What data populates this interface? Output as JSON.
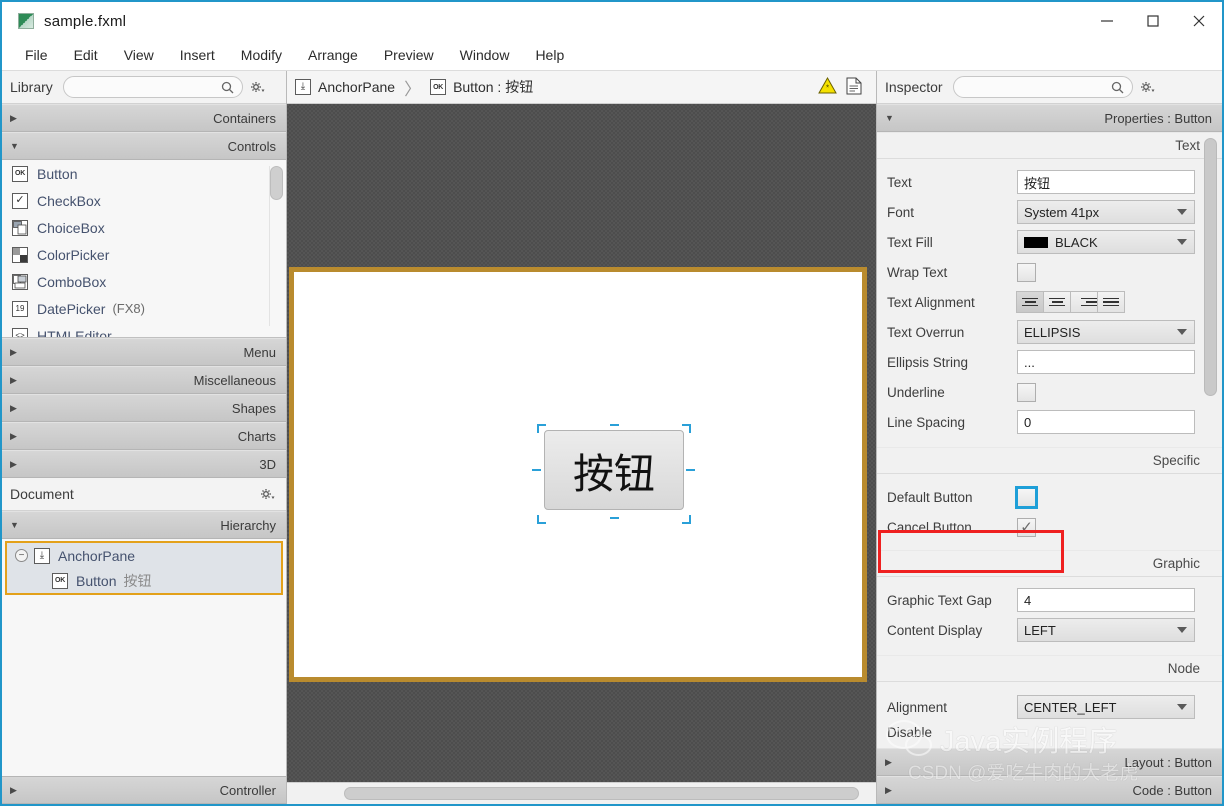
{
  "window": {
    "title": "sample.fxml",
    "app_icon": "fxml-file-icon",
    "buttons": {
      "minimize": "—",
      "maximize": "□",
      "close": "✕"
    }
  },
  "menubar": {
    "items": [
      "File",
      "Edit",
      "View",
      "Insert",
      "Modify",
      "Arrange",
      "Preview",
      "Window",
      "Help"
    ]
  },
  "library": {
    "title": "Library",
    "search_placeholder": "",
    "search_value": "",
    "gear_label": "⚙",
    "sections": [
      {
        "label": "Containers",
        "expanded": false
      },
      {
        "label": "Controls",
        "expanded": true
      },
      {
        "label": "Menu",
        "expanded": false
      },
      {
        "label": "Miscellaneous",
        "expanded": false
      },
      {
        "label": "Shapes",
        "expanded": false
      },
      {
        "label": "Charts",
        "expanded": false
      },
      {
        "label": "3D",
        "expanded": false
      }
    ],
    "controls": [
      {
        "icon": "ok-button-icon",
        "glyph": "OK",
        "label": "Button",
        "sub": ""
      },
      {
        "icon": "checkbox-icon",
        "glyph": "✓",
        "label": "CheckBox",
        "sub": ""
      },
      {
        "icon": "choicebox-icon",
        "glyph": "▤",
        "label": "ChoiceBox",
        "sub": ""
      },
      {
        "icon": "colorpicker-icon",
        "glyph": "▩",
        "label": "ColorPicker",
        "sub": ""
      },
      {
        "icon": "combobox-icon",
        "glyph": "▤",
        "label": "ComboBox",
        "sub": ""
      },
      {
        "icon": "datepicker-icon",
        "glyph": "19",
        "label": "DatePicker",
        "sub": "(FX8)"
      },
      {
        "icon": "htmleditor-icon",
        "glyph": "<>",
        "label": "HTMLEditor",
        "sub": ""
      }
    ]
  },
  "document": {
    "title": "Document",
    "gear_label": "⚙",
    "hierarchy_label": "Hierarchy",
    "controller_label": "Controller",
    "tree": [
      {
        "icon": "anchorpane-icon",
        "glyph": "⤓",
        "label": "AnchorPane",
        "value": "",
        "selected": false,
        "depth": 0
      },
      {
        "icon": "ok-button-icon",
        "glyph": "OK",
        "label": "Button",
        "value": "按钮",
        "selected": true,
        "depth": 1
      }
    ]
  },
  "breadcrumb": {
    "items": [
      {
        "icon": "anchorpane-icon",
        "glyph": "⤓",
        "label": "AnchorPane"
      },
      {
        "icon": "ok-button-icon",
        "glyph": "OK",
        "label": "Button : 按钮"
      }
    ],
    "separator": "〉",
    "warning_icon": "warning-triangle-icon",
    "preview_icon": "document-page-icon"
  },
  "canvas": {
    "root_node": "AnchorPane",
    "button_text": "按钮",
    "button_font_size": "41px",
    "border_color": "#b98b2e",
    "selection_color": "#2aa0d8",
    "background": "#555555"
  },
  "inspector": {
    "title": "Inspector",
    "search_placeholder": "",
    "search_value": "",
    "gear_label": "⚙",
    "properties_header": "Properties : Button",
    "groups": {
      "text": "Text",
      "specific": "Specific",
      "graphic": "Graphic",
      "node": "Node"
    },
    "text_props": [
      {
        "label": "Text",
        "type": "input",
        "value": "按钮"
      },
      {
        "label": "Font",
        "type": "combo",
        "value": "System 41px"
      },
      {
        "label": "Text Fill",
        "type": "color-combo",
        "value": "BLACK",
        "color": "#000000"
      },
      {
        "label": "Wrap Text",
        "type": "checkbox",
        "checked": false
      },
      {
        "label": "Text Alignment",
        "type": "align",
        "selected": 0
      },
      {
        "label": "Text Overrun",
        "type": "combo",
        "value": "ELLIPSIS"
      },
      {
        "label": "Ellipsis String",
        "type": "input",
        "value": "..."
      },
      {
        "label": "Underline",
        "type": "checkbox",
        "checked": false
      },
      {
        "label": "Line Spacing",
        "type": "input",
        "value": "0"
      }
    ],
    "specific_props": [
      {
        "label": "Default Button",
        "type": "checkbox",
        "checked": false,
        "focused": true
      },
      {
        "label": "Cancel Button",
        "type": "checkbox",
        "checked": true,
        "highlighted": true
      }
    ],
    "graphic_props": [
      {
        "label": "Graphic Text Gap",
        "type": "input",
        "value": "4"
      },
      {
        "label": "Content Display",
        "type": "combo",
        "value": "LEFT"
      }
    ],
    "node_props": [
      {
        "label": "Alignment",
        "type": "combo",
        "value": "CENTER_LEFT"
      }
    ],
    "bottom_sections": [
      {
        "label": "Layout : Button"
      },
      {
        "label": "Code : Button"
      }
    ]
  },
  "watermark": {
    "main": "Java实例程序",
    "sub": "CSDN @爱吃牛肉的大老虎",
    "logo": "wechat-logo-icon"
  }
}
